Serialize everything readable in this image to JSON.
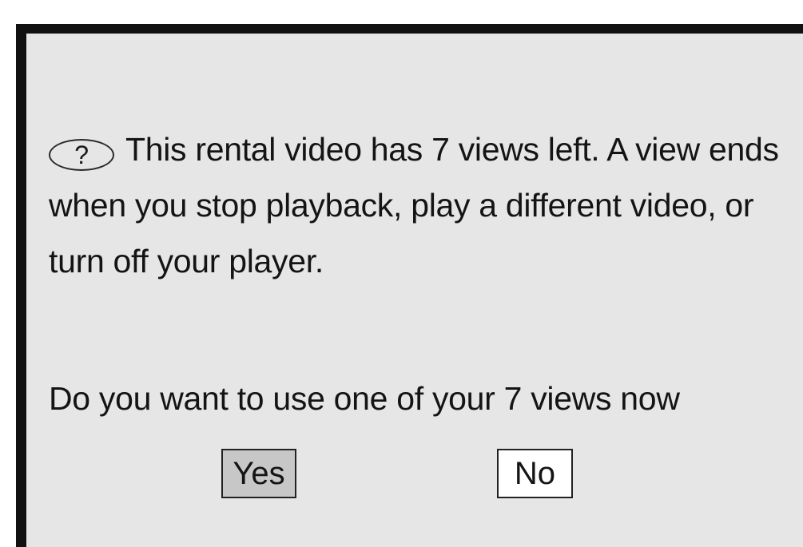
{
  "dialog": {
    "icon": "question-icon",
    "icon_glyph": "?",
    "message": "This rental video has 7 views left. A view ends when you stop playback, play a different video, or turn off your player.",
    "question": "Do you want to use one of your 7 views now",
    "buttons": {
      "yes_label": "Yes",
      "no_label": "No",
      "selected": "Yes"
    }
  },
  "colors": {
    "dialog_background": "#e6e6e6",
    "dialog_border": "#111111",
    "selected_button": "#c7c7c7",
    "unselected_button": "#ffffff",
    "text": "#141414"
  }
}
